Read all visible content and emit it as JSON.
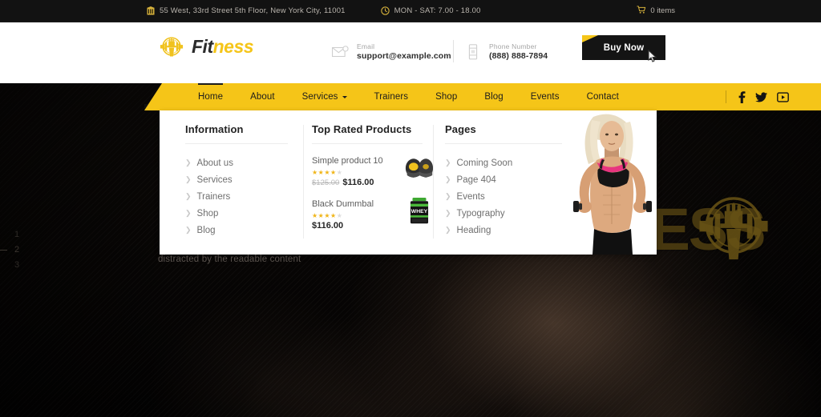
{
  "topbar": {
    "address": "55 West, 33rd Street 5th Floor, New York City, 11001",
    "address_icon": "building-icon",
    "hours": "MON - SAT: 7.00 - 18.00",
    "hours_icon": "clock-icon",
    "cart_text": "0 items",
    "cart_icon": "shopping-cart-icon"
  },
  "header": {
    "logo_fit": "Fit",
    "logo_ness": "ness",
    "logo_icon": "fist-barbell-logo-icon",
    "email_label": "Email",
    "email_value": "support@example.com",
    "email_icon": "envelope-icon",
    "phone_label": "Phone Number",
    "phone_value": "(888) 888-7894",
    "phone_icon": "mobile-phone-icon",
    "buy_label": "Buy Now"
  },
  "nav": {
    "items": [
      {
        "label": "Home",
        "active": true,
        "has_caret": false
      },
      {
        "label": "About",
        "active": false,
        "has_caret": false
      },
      {
        "label": "Services",
        "active": false,
        "has_caret": true
      },
      {
        "label": "Trainers",
        "active": false,
        "has_caret": false
      },
      {
        "label": "Shop",
        "active": false,
        "has_caret": false
      },
      {
        "label": "Blog",
        "active": false,
        "has_caret": false
      },
      {
        "label": "Events",
        "active": false,
        "has_caret": false
      },
      {
        "label": "Contact",
        "active": false,
        "has_caret": false
      }
    ],
    "social": [
      {
        "name": "facebook-icon"
      },
      {
        "name": "twitter-icon"
      },
      {
        "name": "youtube-icon"
      }
    ]
  },
  "mega": {
    "information": {
      "title": "Information",
      "links": [
        "About us",
        "Services",
        "Trainers",
        "Shop",
        "Blog"
      ]
    },
    "products": {
      "title": "Top Rated Products",
      "items": [
        {
          "name": "Simple product 10",
          "rating": 4,
          "old_price": "$125.00",
          "price": "$116.00",
          "thumb": "boxing-pads-thumb"
        },
        {
          "name": "Black Dummbal",
          "rating": 4,
          "old_price": "",
          "price": "$116.00",
          "thumb": "whey-protein-thumb"
        }
      ]
    },
    "pages": {
      "title": "Pages",
      "links": [
        "Coming Soon",
        "Page 404",
        "Events",
        "Typography",
        "Heading"
      ]
    },
    "promo_image": "fitness-model-photo"
  },
  "hero": {
    "caption": "distracted  by the readable content",
    "watermark_text": "NESS",
    "slides": [
      "1",
      "2",
      "3"
    ],
    "active_slide": "2"
  },
  "colors": {
    "accent": "#f5c518",
    "dark": "#141414",
    "topbar_bg": "#121212",
    "star": "#f0b518"
  }
}
